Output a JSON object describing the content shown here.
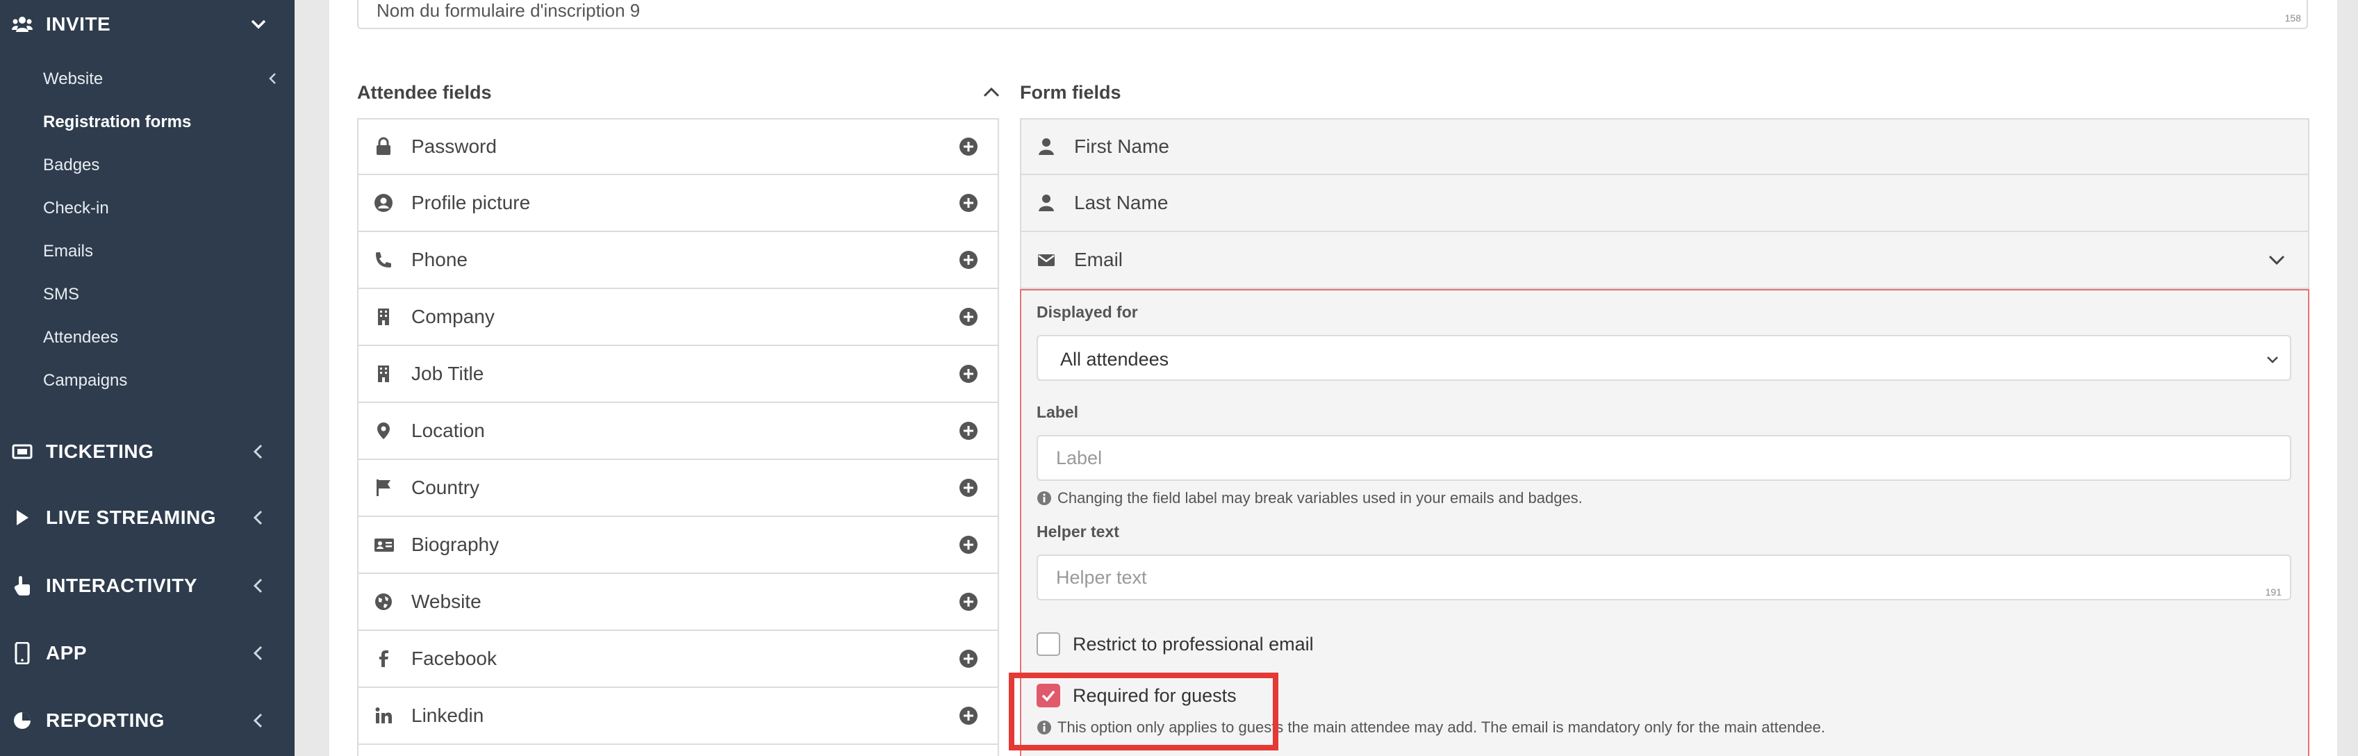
{
  "sidebar": {
    "invite": {
      "label": "INVITE",
      "icon": "users-icon"
    },
    "invite_items": [
      {
        "label": "Website"
      },
      {
        "label": "Registration forms"
      },
      {
        "label": "Badges"
      },
      {
        "label": "Check-in"
      },
      {
        "label": "Emails"
      },
      {
        "label": "SMS"
      },
      {
        "label": "Attendees"
      },
      {
        "label": "Campaigns"
      }
    ],
    "sections": [
      {
        "label": "TICKETING",
        "icon": "ticket-icon"
      },
      {
        "label": "LIVE STREAMING",
        "icon": "play-icon"
      },
      {
        "label": "INTERACTIVITY",
        "icon": "hand-pointer-icon"
      },
      {
        "label": "APP",
        "icon": "mobile-icon"
      },
      {
        "label": "REPORTING",
        "icon": "pie-chart-icon"
      }
    ]
  },
  "form_name": {
    "value": "Nom du formulaire d'inscription 9",
    "counter": "158"
  },
  "attendee_fields": {
    "title": "Attendee fields",
    "items": [
      {
        "label": "Password",
        "icon": "lock-icon"
      },
      {
        "label": "Profile picture",
        "icon": "user-circle-icon"
      },
      {
        "label": "Phone",
        "icon": "phone-icon"
      },
      {
        "label": "Company",
        "icon": "building-icon"
      },
      {
        "label": "Job Title",
        "icon": "building-icon"
      },
      {
        "label": "Location",
        "icon": "map-marker-icon"
      },
      {
        "label": "Country",
        "icon": "flag-icon"
      },
      {
        "label": "Biography",
        "icon": "id-card-icon"
      },
      {
        "label": "Website",
        "icon": "globe-icon"
      },
      {
        "label": "Facebook",
        "icon": "facebook-icon"
      },
      {
        "label": "Linkedin",
        "icon": "linkedin-icon"
      }
    ]
  },
  "form_fields": {
    "title": "Form fields",
    "items": [
      {
        "label": "First Name",
        "icon": "user-icon"
      },
      {
        "label": "Last Name",
        "icon": "user-icon"
      },
      {
        "label": "Email",
        "icon": "envelope-icon"
      }
    ]
  },
  "email_panel": {
    "displayed_for_label": "Displayed for",
    "displayed_for_value": "All attendees",
    "label_label": "Label",
    "label_placeholder": "Label",
    "label_hint": "Changing the field label may break variables used in your emails and badges.",
    "helper_label": "Helper text",
    "helper_placeholder": "Helper text",
    "helper_counter": "191",
    "restrict_label": "Restrict to professional email",
    "restrict_checked": false,
    "required_label": "Required for guests",
    "required_checked": true,
    "required_hint": "This option only applies to guests the main attendee may add. The email is mandatory only for the main attendee."
  },
  "colors": {
    "sidebar_bg": "#2e3c4d",
    "accent_red": "#e53935",
    "checkbox_checked": "#e05a6b",
    "panel_border": "#e57373"
  }
}
